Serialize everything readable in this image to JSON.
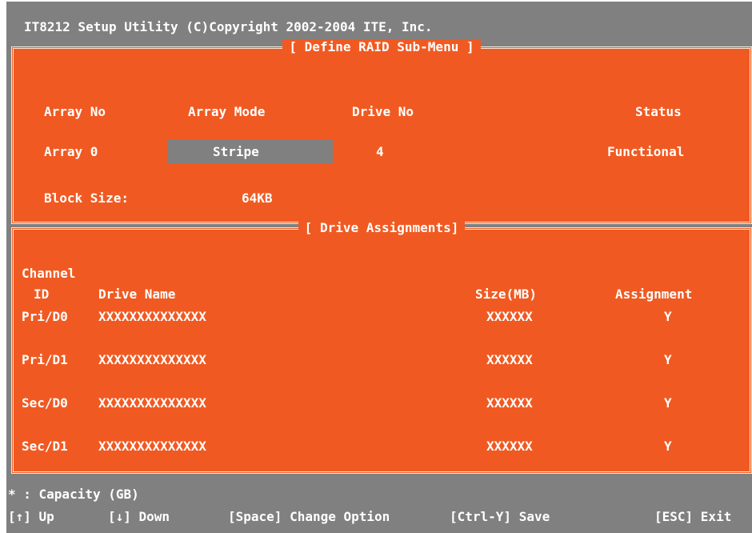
{
  "header": {
    "title": "IT8212 Setup Utility (C)Copyright 2002-2004 ITE, Inc."
  },
  "define_raid": {
    "title": "[ Define RAID Sub-Menu ]",
    "columns": {
      "array_no": "Array No",
      "array_mode": "Array Mode",
      "drive_no": "Drive No",
      "status": "Status"
    },
    "row": {
      "array": "Array 0",
      "mode": "Stripe",
      "drive_no": "4",
      "status": "Functional"
    },
    "block_size_label": "Block Size:",
    "block_size_value": "64KB"
  },
  "drive_assignments": {
    "title": "[ Drive Assignments]",
    "columns": {
      "channel": "Channel",
      "id": "ID",
      "drive_name": "Drive Name",
      "size": "Size(MB)",
      "assignment": "Assignment"
    },
    "rows": [
      {
        "channel": "Pri/D0",
        "name": "XXXXXXXXXXXXXX",
        "size": "XXXXXX",
        "assignment": "Y"
      },
      {
        "channel": "Pri/D1",
        "name": "XXXXXXXXXXXXXX",
        "size": "XXXXXX",
        "assignment": "Y"
      },
      {
        "channel": "Sec/D0",
        "name": "XXXXXXXXXXXXXX",
        "size": "XXXXXX",
        "assignment": "Y"
      },
      {
        "channel": "Sec/D1",
        "name": "XXXXXXXXXXXXXX",
        "size": "XXXXXX",
        "assignment": "Y"
      }
    ]
  },
  "footer": {
    "note": "* : Capacity (GB)",
    "keys": {
      "up": "[↑] Up",
      "down": "[↓] Down",
      "change": "[Space] Change Option",
      "save": "[Ctrl-Y] Save",
      "exit": "[ESC] Exit"
    }
  },
  "colors": {
    "panel": "#f05a22",
    "chrome": "#808080",
    "text": "#ffffff"
  }
}
